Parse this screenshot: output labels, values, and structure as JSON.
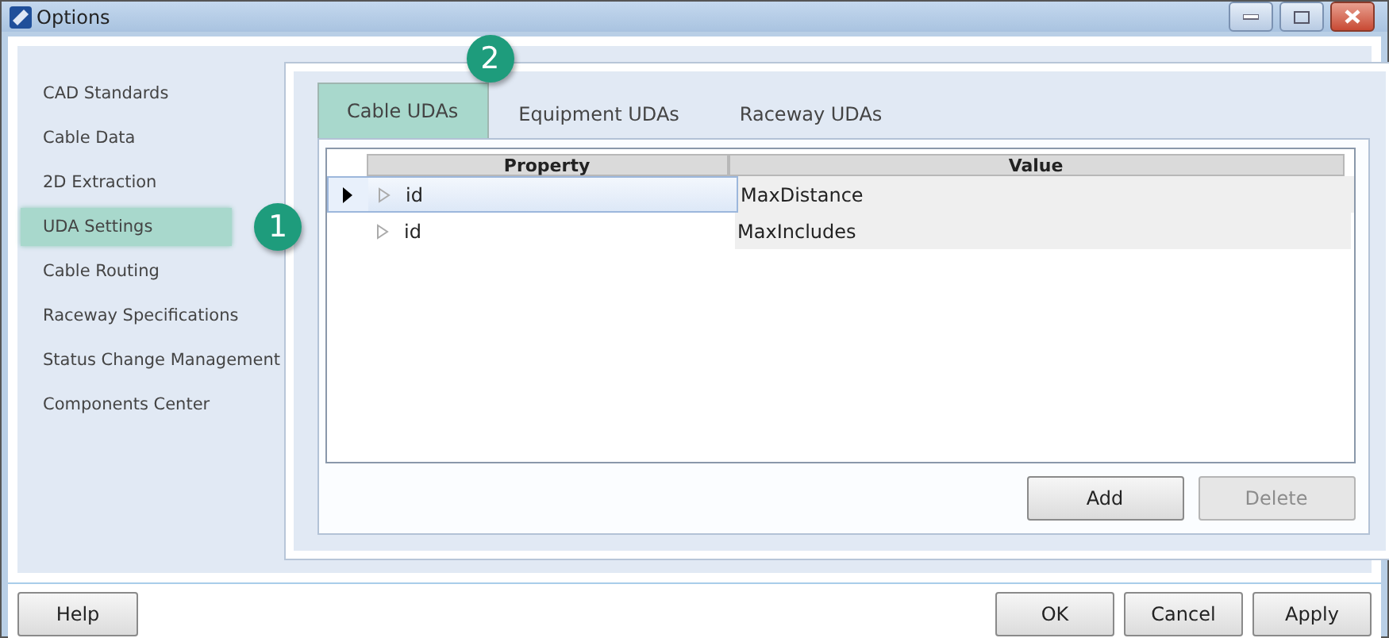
{
  "window": {
    "title": "Options"
  },
  "sidebar": {
    "items": [
      {
        "label": "CAD Standards",
        "selected": false
      },
      {
        "label": "Cable Data",
        "selected": false
      },
      {
        "label": "2D Extraction",
        "selected": false
      },
      {
        "label": "UDA Settings",
        "selected": true,
        "callout": "1"
      },
      {
        "label": "Cable Routing",
        "selected": false
      },
      {
        "label": "Raceway Specifications",
        "selected": false
      },
      {
        "label": "Status Change Management",
        "selected": false
      },
      {
        "label": "Components Center",
        "selected": false
      }
    ]
  },
  "tabs": [
    {
      "label": "Cable UDAs",
      "selected": true,
      "callout": "2"
    },
    {
      "label": "Equipment UDAs",
      "selected": false
    },
    {
      "label": "Raceway UDAs",
      "selected": false
    }
  ],
  "table": {
    "columns": [
      "Property",
      "Value"
    ],
    "rows": [
      {
        "current": true,
        "property": "id",
        "value": "MaxDistance"
      },
      {
        "current": false,
        "property": "id",
        "value": "MaxIncludes"
      }
    ]
  },
  "table_buttons": [
    {
      "label": "Add",
      "disabled": false
    },
    {
      "label": "Delete",
      "disabled": true
    }
  ],
  "footer": {
    "left": [
      {
        "label": "Help"
      }
    ],
    "right": [
      {
        "label": "OK"
      },
      {
        "label": "Cancel"
      },
      {
        "label": "Apply"
      }
    ]
  }
}
